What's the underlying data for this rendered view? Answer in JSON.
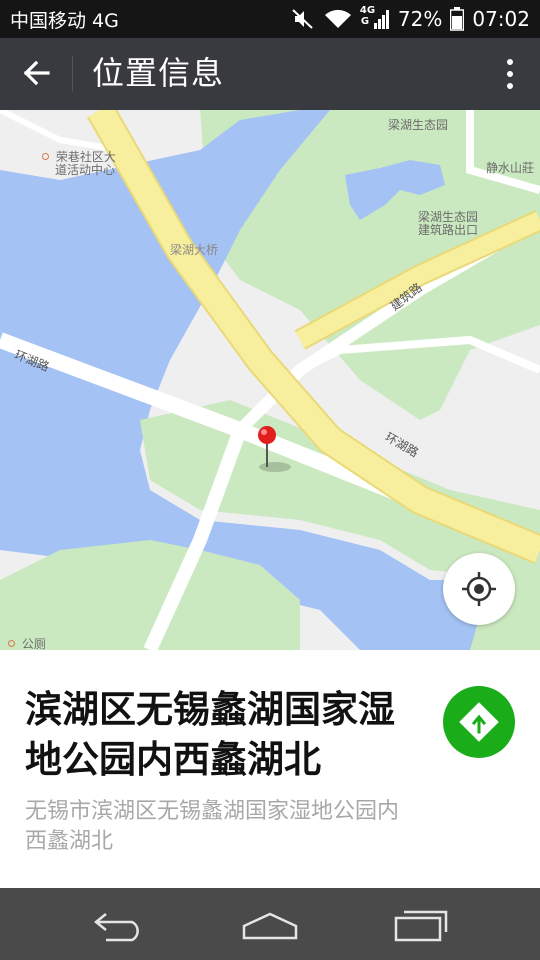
{
  "status_bar": {
    "carrier": "中国移动 4G",
    "network_badge_top": "4G",
    "network_badge_bottom": "G",
    "battery": "72%",
    "time": "07:02",
    "icons": [
      "mute-icon",
      "wifi-icon",
      "signal-icon",
      "battery-icon"
    ]
  },
  "toolbar": {
    "title": "位置信息",
    "icons": [
      "back-arrow-icon",
      "more-vert-icon"
    ]
  },
  "map": {
    "labels": {
      "community_center_1": "荣巷社区大",
      "community_center_2": "道活动中心",
      "ecology_park": "梁湖生态园",
      "jingshui": "静水山莊",
      "exit_1": "梁湖生态园",
      "exit_2": "建筑路出口",
      "bridge": "梁湖大桥",
      "jianzhu_road": "建筑路",
      "huanhu_road_left": "环湖路",
      "huanhu_road_right": "环湖路",
      "toilet": "公厕"
    },
    "colors": {
      "land": "#efeff0",
      "water": "#a4c2f4",
      "park": "#cbe9c0",
      "road_major": "#f7ef9e",
      "road_minor": "#ffffff",
      "pin": "#e11d1d"
    },
    "icons": [
      "location-pin-icon",
      "my-location-icon"
    ]
  },
  "place": {
    "name": "滨湖区无锡蠡湖国家湿地公园内西蠡湖北",
    "address": "无锡市滨湖区无锡蠡湖国家湿地公园内西蠡湖北",
    "accent": "#1aad19",
    "icons": [
      "directions-icon"
    ]
  },
  "nav_bar": {
    "icons": [
      "nav-back-icon",
      "nav-home-icon",
      "nav-recents-icon"
    ]
  }
}
